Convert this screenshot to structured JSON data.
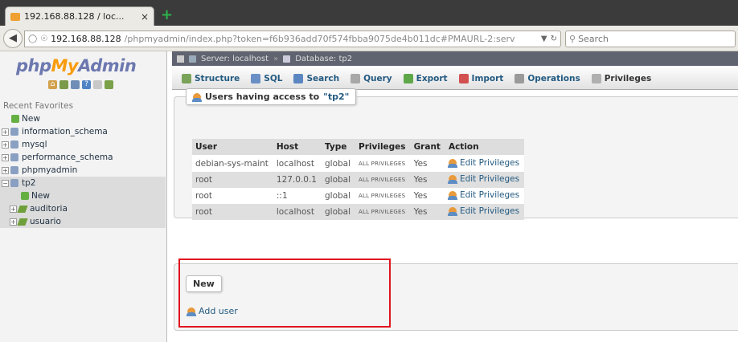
{
  "browser": {
    "tab_title": "192.168.88.128 / loc...",
    "tab_close": "×",
    "new_tab": "+",
    "url_host": "192.168.88.128",
    "url_path": "/phpmyadmin/index.php?token=f6b936add70f574fbba9075de4b011dc#PMAURL-2:serv",
    "search_placeholder": "Search"
  },
  "sidebar": {
    "logo_php": "php",
    "logo_my": "My",
    "logo_admin": "Admin",
    "recent_favorites": "Recent  Favorites",
    "items": [
      {
        "label": "New"
      },
      {
        "label": "information_schema"
      },
      {
        "label": "mysql"
      },
      {
        "label": "performance_schema"
      },
      {
        "label": "phpmyadmin"
      },
      {
        "label": "tp2"
      },
      {
        "label": "New"
      },
      {
        "label": "auditoria"
      },
      {
        "label": "usuario"
      }
    ]
  },
  "breadcrumb": {
    "server": "Server: localhost",
    "separator": "»",
    "database": "Database: tp2"
  },
  "tabs": [
    {
      "label": "Structure",
      "color": "#7aa35a"
    },
    {
      "label": "SQL",
      "color": "#6a8fc5"
    },
    {
      "label": "Search",
      "color": "#5b86c2"
    },
    {
      "label": "Query",
      "color": "#a8a8a8"
    },
    {
      "label": "Export",
      "color": "#5fa84a"
    },
    {
      "label": "Import",
      "color": "#d25050"
    },
    {
      "label": "Operations",
      "color": "#9a9a9a"
    },
    {
      "label": "Privileges",
      "color": "#b0b0b0"
    }
  ],
  "access": {
    "legend_prefix": "Users having access to ",
    "legend_db": "\"tp2\"",
    "headers": {
      "user": "User",
      "host": "Host",
      "type": "Type",
      "privileges": "Privileges",
      "grant": "Grant",
      "action": "Action"
    },
    "rows": [
      {
        "user": "debian-sys-maint",
        "host": "localhost",
        "type": "global",
        "privileges": "ALL PRIVILEGES",
        "grant": "Yes",
        "action": "Edit Privileges"
      },
      {
        "user": "root",
        "host": "127.0.0.1",
        "type": "global",
        "privileges": "ALL PRIVILEGES",
        "grant": "Yes",
        "action": "Edit Privileges"
      },
      {
        "user": "root",
        "host": "::1",
        "type": "global",
        "privileges": "ALL PRIVILEGES",
        "grant": "Yes",
        "action": "Edit Privileges"
      },
      {
        "user": "root",
        "host": "localhost",
        "type": "global",
        "privileges": "ALL PRIVILEGES",
        "grant": "Yes",
        "action": "Edit Privileges"
      }
    ]
  },
  "new_section": {
    "legend": "New",
    "add_user": "Add user"
  },
  "highlight_color": "#e0141e"
}
